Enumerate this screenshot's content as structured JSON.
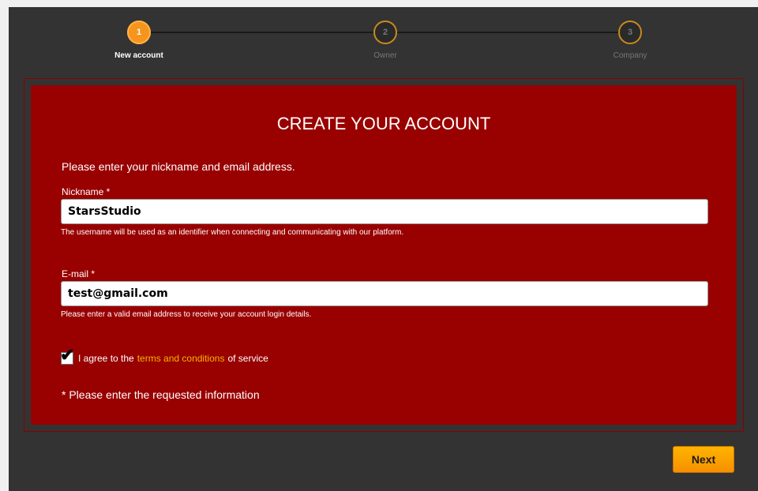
{
  "stepper": {
    "steps": [
      {
        "number": "1",
        "label": "New account",
        "state": "active"
      },
      {
        "number": "2",
        "label": "Owner",
        "state": "inactive"
      },
      {
        "number": "3",
        "label": "Company",
        "state": "inactive"
      }
    ]
  },
  "form": {
    "title": "CREATE YOUR ACCOUNT",
    "intro": "Please enter your nickname and email address.",
    "nickname": {
      "label": "Nickname *",
      "value": "StarsStudio",
      "help": "The username will be used as an identifier when connecting and communicating with our platform."
    },
    "email": {
      "label": "E-mail *",
      "value": "test@gmail.com",
      "help": "Please enter a valid email address to receive your account login details."
    },
    "agree": {
      "checked": true,
      "prefix": "I agree to the",
      "link": "terms and conditions",
      "suffix": "of service"
    },
    "required_note": "* Please enter the requested information"
  },
  "actions": {
    "next_label": "Next"
  },
  "colors": {
    "panel_bg": "#333333",
    "card_bg": "#990000",
    "accent": "#f7941d",
    "link": "#f7b500"
  }
}
